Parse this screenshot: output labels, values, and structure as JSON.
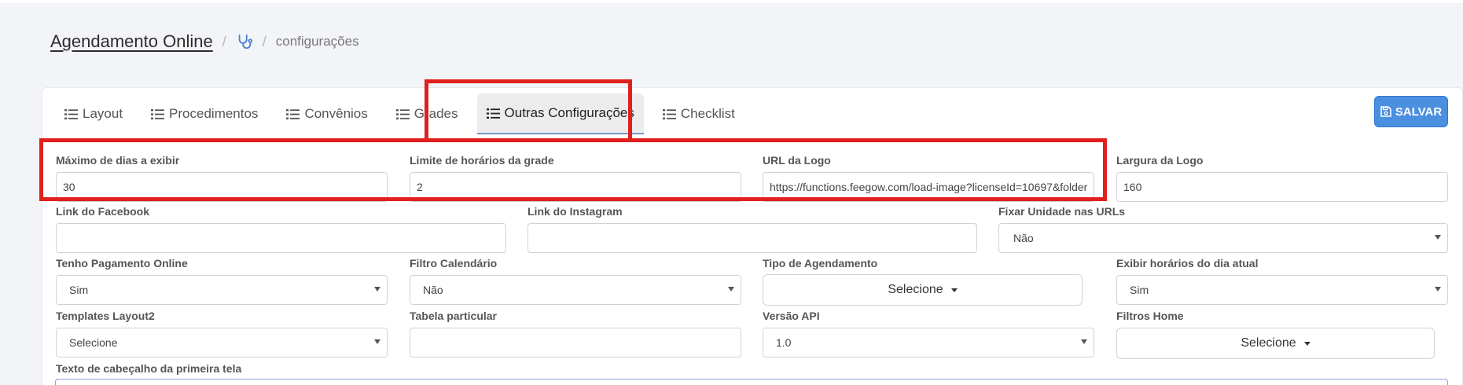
{
  "breadcrumb": {
    "title": "Agendamento Online",
    "current": "configurações"
  },
  "tabs": [
    {
      "label": "Layout"
    },
    {
      "label": "Procedimentos"
    },
    {
      "label": "Convênios"
    },
    {
      "label": "Grades"
    },
    {
      "label": "Outras Configurações"
    },
    {
      "label": "Checklist"
    }
  ],
  "active_tab": "Outras Configurações",
  "save_button": {
    "label": "SALVAR"
  },
  "form": {
    "max_dias": {
      "label": "Máximo de dias a exibir",
      "value": "30"
    },
    "limite_horarios": {
      "label": "Limite de horários da grade",
      "value": "2"
    },
    "url_logo": {
      "label": "URL da Logo",
      "value": "https://functions.feegow.com/load-image?licenseId=10697&folder"
    },
    "largura_logo": {
      "label": "Largura da Logo",
      "value": "160"
    },
    "link_facebook": {
      "label": "Link do Facebook",
      "value": ""
    },
    "link_instagram": {
      "label": "Link do Instagram",
      "value": ""
    },
    "fixar_unidade": {
      "label": "Fixar Unidade nas URLs",
      "value": "Não"
    },
    "pagamento_online": {
      "label": "Tenho Pagamento Online",
      "value": "Sim"
    },
    "filtro_calendario": {
      "label": "Filtro Calendário",
      "value": "Não"
    },
    "tipo_agendamento": {
      "label": "Tipo de Agendamento",
      "value": "Selecione"
    },
    "exibir_horarios": {
      "label": "Exibir horários do dia atual",
      "value": "Sim"
    },
    "templates_layout2": {
      "label": "Templates Layout2",
      "value": "Selecione"
    },
    "tabela_particular": {
      "label": "Tabela particular",
      "value": ""
    },
    "versao_api": {
      "label": "Versão API",
      "value": "1.0"
    },
    "filtros_home": {
      "label": "Filtros Home",
      "value": "Selecione"
    },
    "texto_cabecalho": {
      "label": "Texto de cabeçalho da primeira tela",
      "value": ""
    }
  },
  "colors": {
    "highlight": "#e0201e",
    "primary": "#4a8fe0",
    "active_tab_bg": "#ececed"
  },
  "icons": {
    "tab_icon": "list-icon",
    "breadcrumb_icon": "stethoscope-icon",
    "save_icon": "floppy-disk-icon"
  }
}
